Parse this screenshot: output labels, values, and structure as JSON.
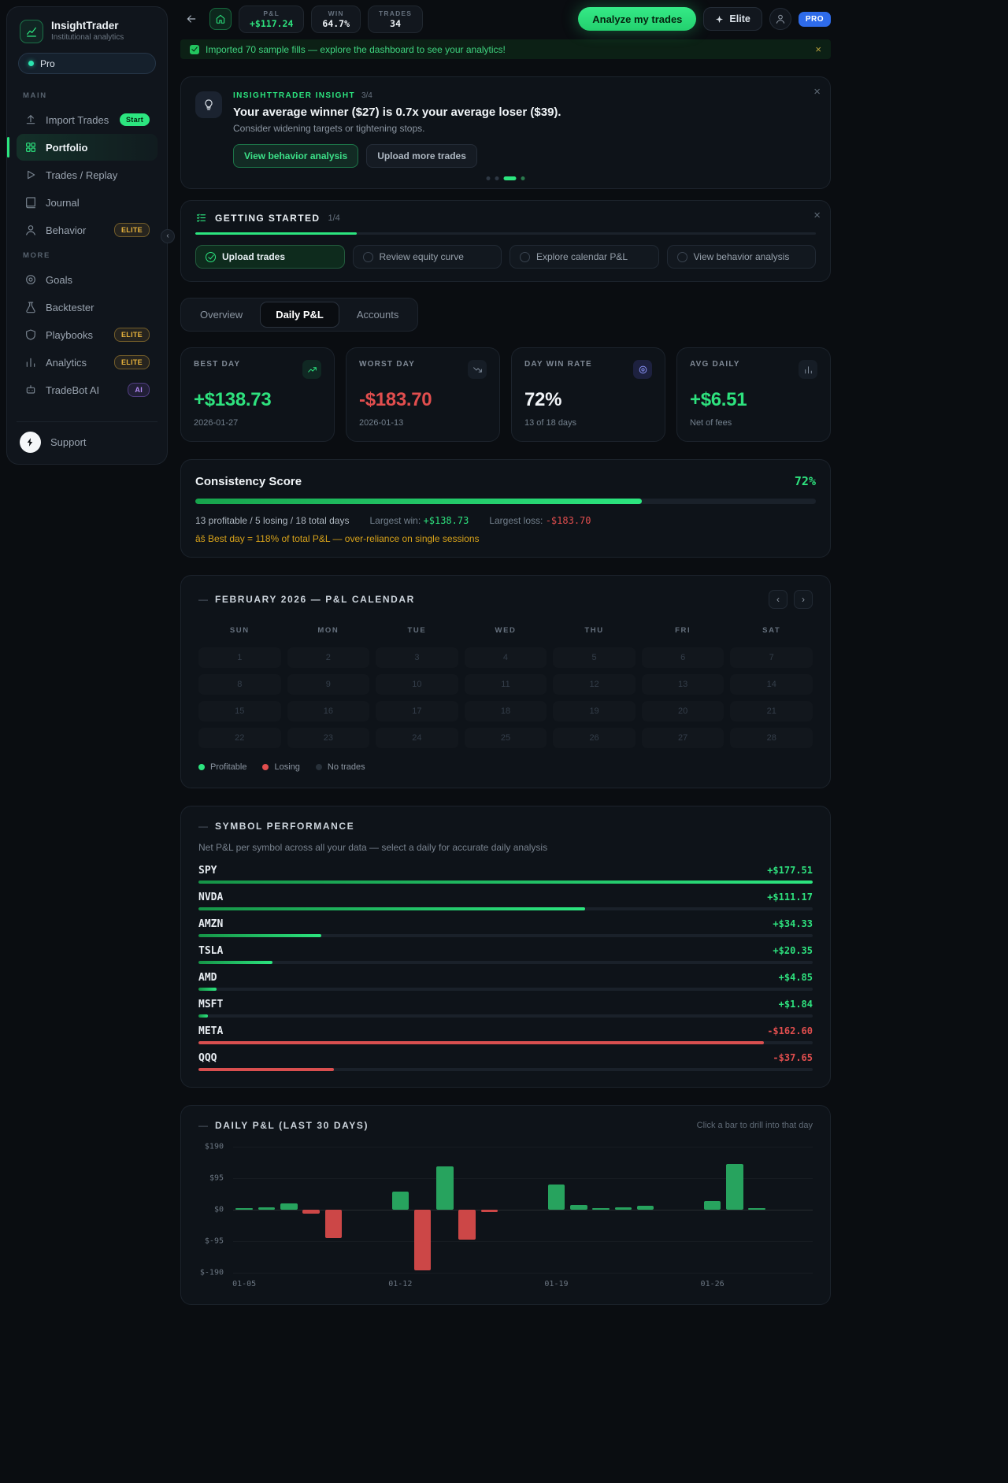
{
  "sidebar": {
    "brand": {
      "name": "InsightTrader",
      "subtitle": "Institutional analytics"
    },
    "plan_pill": "Pro",
    "sections": [
      {
        "label": "MAIN",
        "items": [
          {
            "label": "Import Trades",
            "icon": "upload-icon",
            "badge": "Start",
            "badge_style": "green"
          },
          {
            "label": "Portfolio",
            "icon": "grid-icon",
            "active": true
          },
          {
            "label": "Trades / Replay",
            "icon": "play-icon"
          },
          {
            "label": "Journal",
            "icon": "book-icon"
          },
          {
            "label": "Behavior",
            "icon": "head-icon",
            "badge": "ELITE",
            "badge_style": "amber"
          }
        ]
      },
      {
        "label": "MORE",
        "items": [
          {
            "label": "Goals",
            "icon": "target-icon"
          },
          {
            "label": "Backtester",
            "icon": "flask-icon"
          },
          {
            "label": "Playbooks",
            "icon": "shield-icon",
            "badge": "ELITE",
            "badge_style": "amber"
          },
          {
            "label": "Analytics",
            "icon": "bars-icon",
            "badge": "ELITE",
            "badge_style": "amber"
          },
          {
            "label": "TradeBot AI",
            "icon": "bot-icon",
            "badge": "AI",
            "badge_style": "purple"
          }
        ]
      }
    ],
    "support_label": "Support"
  },
  "topbar": {
    "stats": [
      {
        "label": "P&L",
        "value": "+$117.24",
        "tone": "green"
      },
      {
        "label": "WIN",
        "value": "64.7%",
        "tone": "white"
      },
      {
        "label": "TRADES",
        "value": "34",
        "tone": "white"
      }
    ],
    "analyze_button": "Analyze my trades",
    "elite_button": "Elite",
    "pro_badge": "PRO"
  },
  "banner": {
    "text": "Imported 70 sample fills — explore the dashboard to see your analytics!"
  },
  "insight": {
    "kicker": "INSIGHTTRADER INSIGHT",
    "counter": "3/4",
    "title": "Your average winner ($27) is 0.7x your average loser ($39).",
    "subtitle": "Consider widening targets or tightening stops.",
    "primary_button": "View behavior analysis",
    "secondary_button": "Upload more trades",
    "dots_total": 4,
    "dots_active_index": 2
  },
  "getting_started": {
    "title": "GETTING STARTED",
    "counter": "1/4",
    "progress_pct": 26,
    "steps": [
      {
        "label": "Upload trades",
        "done": true
      },
      {
        "label": "Review equity curve",
        "done": false
      },
      {
        "label": "Explore calendar P&L",
        "done": false
      },
      {
        "label": "View behavior analysis",
        "done": false
      }
    ]
  },
  "tabs": [
    {
      "label": "Overview",
      "active": false
    },
    {
      "label": "Daily P&L",
      "active": true
    },
    {
      "label": "Accounts",
      "active": false
    }
  ],
  "stat_cards": [
    {
      "label": "BEST DAY",
      "value": "+$138.73",
      "sub": "2026-01-27",
      "tone": "pos",
      "icon": "trend-up-icon",
      "icon_style": "g"
    },
    {
      "label": "WORST DAY",
      "value": "-$183.70",
      "sub": "2026-01-13",
      "tone": "neg",
      "icon": "trend-down-icon",
      "icon_style": "n"
    },
    {
      "label": "DAY WIN RATE",
      "value": "72%",
      "sub": "13 of 18 days",
      "tone": "white",
      "icon": "target-icon",
      "icon_style": "i"
    },
    {
      "label": "AVG DAILY",
      "value": "+$6.51",
      "sub": "Net of fees",
      "tone": "pos",
      "icon": "bars-icon",
      "icon_style": "n"
    }
  ],
  "consistency": {
    "title": "Consistency Score",
    "score": "72%",
    "progress_pct": 72,
    "summary": "13 profitable / 5 losing / 18 total days",
    "largest_win_label": "Largest win:",
    "largest_win": "+$138.73",
    "largest_loss_label": "Largest loss:",
    "largest_loss": "-$183.70",
    "warning": "âš Best day = 118% of total P&L — over-reliance on single sessions"
  },
  "calendar": {
    "title": "FEBRUARY 2026 — P&L CALENDAR",
    "weekdays": [
      "SUN",
      "MON",
      "TUE",
      "WED",
      "THU",
      "FRI",
      "SAT"
    ],
    "days": [
      1,
      2,
      3,
      4,
      5,
      6,
      7,
      8,
      9,
      10,
      11,
      12,
      13,
      14,
      15,
      16,
      17,
      18,
      19,
      20,
      21,
      22,
      23,
      24,
      25,
      26,
      27,
      28
    ],
    "legend": [
      {
        "label": "Profitable",
        "color": "#2ce57f"
      },
      {
        "label": "Losing",
        "color": "#e14e4e"
      },
      {
        "label": "No trades",
        "color": "#273039"
      }
    ]
  },
  "symbols": {
    "title": "SYMBOL PERFORMANCE",
    "subtitle": "Net P&L per symbol across all your data — select a daily for accurate daily analysis",
    "rows": [
      {
        "symbol": "SPY",
        "value": "+$177.51",
        "pct": 100,
        "positive": true
      },
      {
        "symbol": "NVDA",
        "value": "+$111.17",
        "pct": 63,
        "positive": true
      },
      {
        "symbol": "AMZN",
        "value": "+$34.33",
        "pct": 20,
        "positive": true
      },
      {
        "symbol": "TSLA",
        "value": "+$20.35",
        "pct": 12,
        "positive": true
      },
      {
        "symbol": "AMD",
        "value": "+$4.85",
        "pct": 3,
        "positive": true
      },
      {
        "symbol": "MSFT",
        "value": "+$1.84",
        "pct": 1.5,
        "positive": true
      },
      {
        "symbol": "META",
        "value": "-$162.60",
        "pct": 92,
        "positive": false
      },
      {
        "symbol": "QQQ",
        "value": "-$37.65",
        "pct": 22,
        "positive": false
      }
    ]
  },
  "daily_chart": {
    "type": "bar",
    "title": "DAILY P&L (LAST 30 DAYS)",
    "hint": "Click a bar to drill into that day",
    "ymax": 190,
    "y_ticks": [
      "$190",
      "$95",
      "$0",
      "$-95",
      "$-190"
    ],
    "dates": [
      "01-05",
      "01-06",
      "01-07",
      "01-08",
      "01-09",
      "01-10",
      "01-11",
      "01-12",
      "01-13",
      "01-14",
      "01-15",
      "01-16",
      "01-17",
      "01-18",
      "01-19",
      "01-20",
      "01-21",
      "01-22",
      "01-23",
      "01-24",
      "01-25",
      "01-26",
      "01-27",
      "01-28",
      "01-29",
      "01-30"
    ],
    "values": [
      2,
      8,
      20,
      -12,
      -85,
      null,
      null,
      55,
      -183.7,
      130,
      -90,
      -8,
      null,
      null,
      75,
      15,
      5,
      6,
      12,
      null,
      null,
      25,
      138.73,
      5,
      null,
      null
    ],
    "x_ticks": [
      {
        "label": "01-05",
        "index": 0
      },
      {
        "label": "01-12",
        "index": 7
      },
      {
        "label": "01-19",
        "index": 14
      },
      {
        "label": "01-26",
        "index": 21
      }
    ]
  }
}
